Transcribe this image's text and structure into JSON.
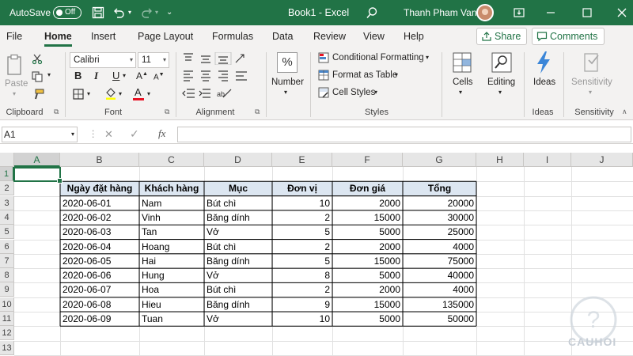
{
  "titlebar": {
    "autosave_label": "AutoSave",
    "autosave_state": "Off",
    "doc_title": "Book1  -  Excel",
    "user_name": "Thanh Pham Van"
  },
  "menu": {
    "tabs": [
      "File",
      "Home",
      "Insert",
      "Page Layout",
      "Formulas",
      "Data",
      "Review",
      "View",
      "Help"
    ],
    "active_tab": "Home",
    "share_label": "Share",
    "comments_label": "Comments"
  },
  "ribbon": {
    "clipboard": {
      "paste_label": "Paste",
      "group_label": "Clipboard"
    },
    "font": {
      "font_name": "Calibri",
      "font_size": "11",
      "group_label": "Font",
      "bold": "B",
      "italic": "I",
      "underline": "U",
      "font_color": "#e81123"
    },
    "alignment": {
      "group_label": "Alignment"
    },
    "number": {
      "label": "Number",
      "icon_text": "%"
    },
    "styles": {
      "conditional": "Conditional Formatting",
      "format_table": "Format as Table",
      "cell_styles": "Cell Styles",
      "group_label": "Styles"
    },
    "cells": {
      "label": "Cells"
    },
    "editing": {
      "label": "Editing"
    },
    "ideas": {
      "label": "Ideas",
      "group_label": "Ideas"
    },
    "sensitivity": {
      "label": "Sensitivity",
      "group_label": "Sensitivity"
    }
  },
  "formula_bar": {
    "name_box": "A1",
    "fx": "fx",
    "cancel": "✕",
    "enter": "✓"
  },
  "grid": {
    "columns": [
      "A",
      "B",
      "C",
      "D",
      "E",
      "F",
      "G",
      "H",
      "I",
      "J"
    ],
    "rows": [
      "1",
      "2",
      "3",
      "4",
      "5",
      "6",
      "7",
      "8",
      "9",
      "10",
      "11",
      "12",
      "13"
    ],
    "table_header": [
      "Ngày đặt hàng",
      "Khách hàng",
      "Mục",
      "Đơn vị",
      "Đơn giá",
      "Tổng"
    ],
    "table_rows": [
      [
        "2020-06-01",
        "Nam",
        "Bút chì",
        "10",
        "2000",
        "20000"
      ],
      [
        "2020-06-02",
        "Vinh",
        "Băng dính",
        "2",
        "15000",
        "30000"
      ],
      [
        "2020-06-03",
        "Tan",
        "Vở",
        "5",
        "5000",
        "25000"
      ],
      [
        "2020-06-04",
        "Hoang",
        "Bút chì",
        "2",
        "2000",
        "4000"
      ],
      [
        "2020-06-05",
        "Hai",
        "Băng dính",
        "5",
        "15000",
        "75000"
      ],
      [
        "2020-06-06",
        "Hung",
        "Vở",
        "8",
        "5000",
        "40000"
      ],
      [
        "2020-06-07",
        "Hoa",
        "Bút chì",
        "2",
        "2000",
        "4000"
      ],
      [
        "2020-06-08",
        "Hieu",
        "Băng dính",
        "9",
        "15000",
        "135000"
      ],
      [
        "2020-06-09",
        "Tuan",
        "Vở",
        "10",
        "5000",
        "50000"
      ]
    ],
    "header_fill": "#dce6f1"
  },
  "watermark": {
    "text": "CAUHOI"
  },
  "colors": {
    "excel_green": "#217346",
    "ribbon_bg": "#f3f2f1"
  }
}
